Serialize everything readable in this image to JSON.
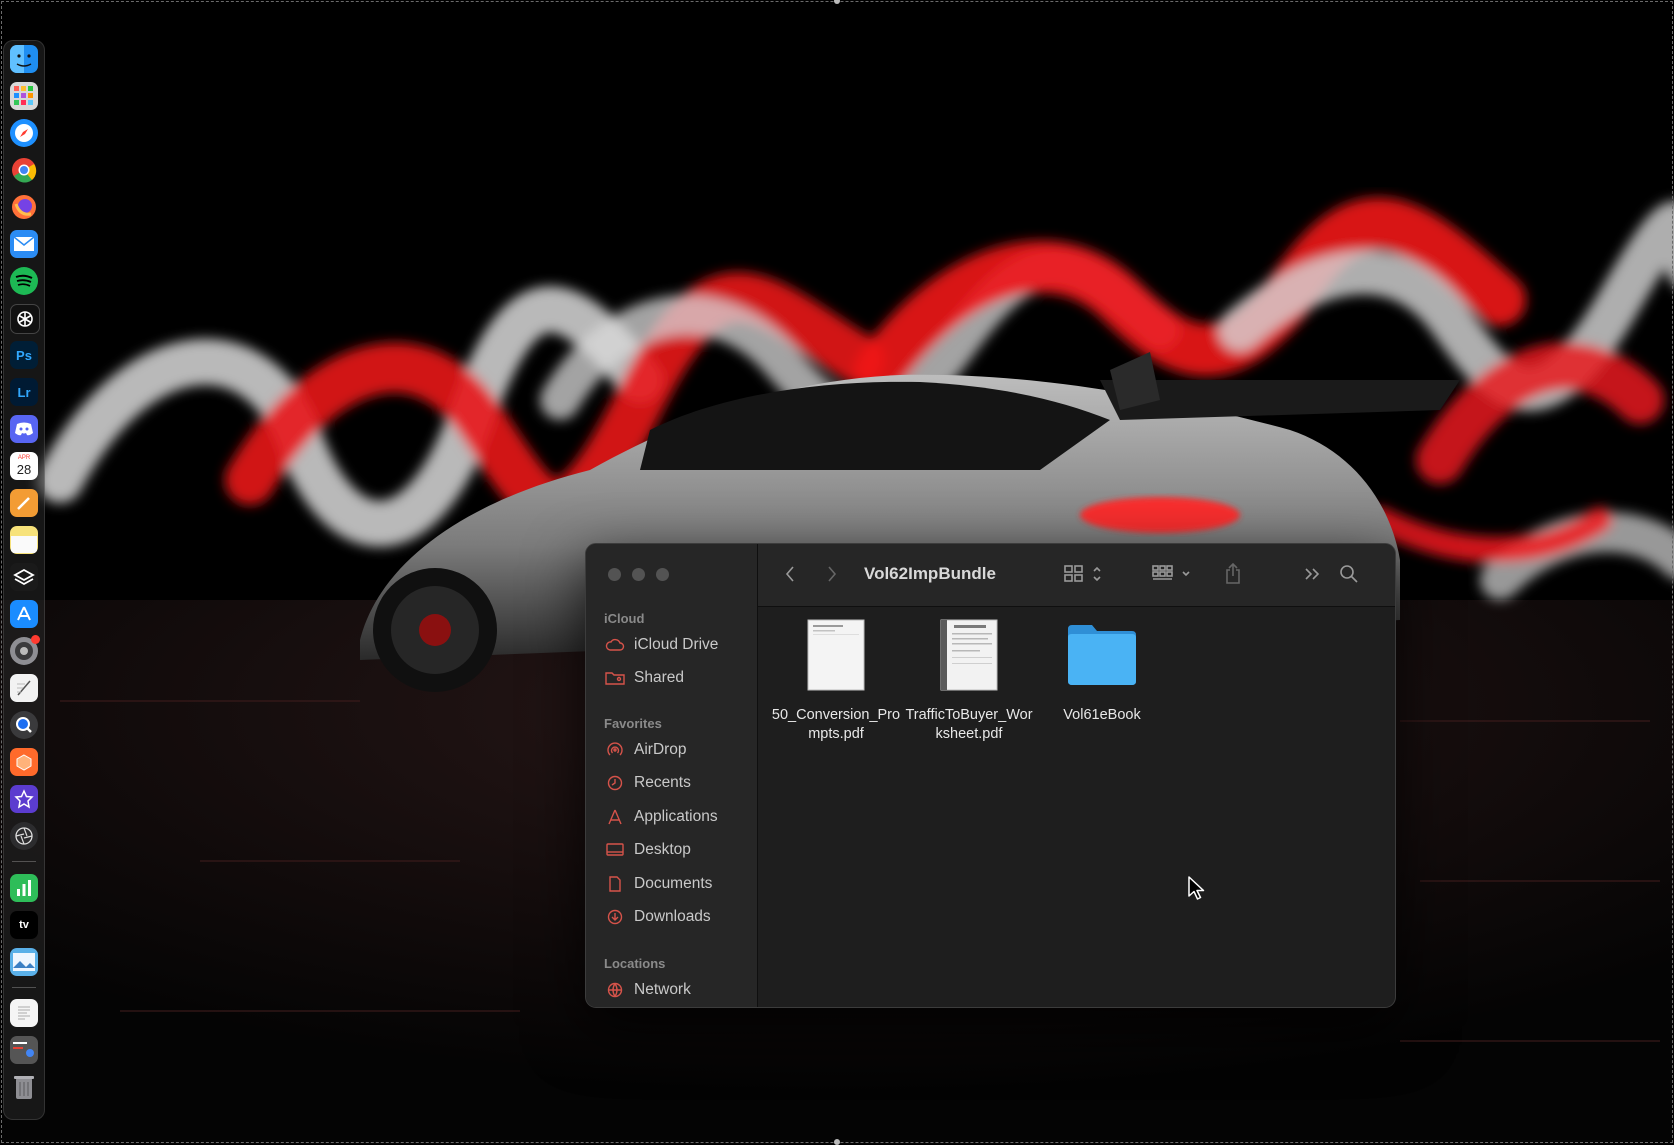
{
  "desktop": {
    "wallpaper": "sports-car-light-painting",
    "dock_apps": [
      {
        "name": "finder-icon",
        "color": "#1f8ef1"
      },
      {
        "name": "launchpad-icon",
        "color": "#e8e8e8"
      },
      {
        "name": "safari-icon",
        "color": "#1e90ff"
      },
      {
        "name": "chrome-icon",
        "color": "#e94235"
      },
      {
        "name": "firefox-icon",
        "color": "#ff7139"
      },
      {
        "name": "mail-icon",
        "color": "#2b8cf4"
      },
      {
        "name": "spotify-icon",
        "color": "#1db954"
      },
      {
        "name": "chatgpt-icon",
        "color": "#111111"
      },
      {
        "name": "photoshop-icon",
        "label": "Ps",
        "color": "#001e36"
      },
      {
        "name": "lightroom-icon",
        "label": "Lr",
        "color": "#001a33"
      },
      {
        "name": "discord-icon",
        "color": "#5865f2"
      },
      {
        "name": "calendar-icon",
        "label": "28",
        "month": "APR",
        "color": "#ffffff"
      },
      {
        "name": "pages-icon",
        "color": "#f39c34"
      },
      {
        "name": "notes-icon",
        "color": "#f7e27a"
      },
      {
        "name": "layers-app-icon",
        "color": "#1a1a1a"
      },
      {
        "name": "app-store-icon",
        "color": "#1a8cff"
      },
      {
        "name": "system-settings-icon",
        "color": "#8e8e93"
      },
      {
        "name": "textedit-icon",
        "color": "#f2f2f2"
      },
      {
        "name": "quicktime-icon",
        "color": "#3a3a3c"
      },
      {
        "name": "cube-app-icon",
        "color": "#ff6a2b"
      },
      {
        "name": "imovie-icon",
        "color": "#5b3ccf"
      },
      {
        "name": "aperture-app-icon",
        "color": "#2c2c2e"
      },
      {
        "name": "numbers-icon",
        "color": "#2ebd59"
      },
      {
        "name": "apple-tv-icon",
        "label": "tv",
        "color": "#000000"
      },
      {
        "name": "preview-icon",
        "color": "#5ab0e8"
      },
      {
        "name": "document-icon",
        "color": "#f5f5f5"
      },
      {
        "name": "recent-stack-icon",
        "color": "#555555"
      },
      {
        "name": "trash-icon",
        "color": "#7a7a7a"
      }
    ]
  },
  "finder": {
    "title": "Vol62ImpBundle",
    "sidebar": {
      "sections": [
        {
          "header": "iCloud",
          "items": [
            {
              "label": "iCloud Drive",
              "icon": "cloud-icon"
            },
            {
              "label": "Shared",
              "icon": "shared-folder-icon"
            }
          ]
        },
        {
          "header": "Favorites",
          "items": [
            {
              "label": "AirDrop",
              "icon": "airdrop-icon"
            },
            {
              "label": "Recents",
              "icon": "clock-icon"
            },
            {
              "label": "Applications",
              "icon": "applications-icon"
            },
            {
              "label": "Desktop",
              "icon": "desktop-icon"
            },
            {
              "label": "Documents",
              "icon": "document-icon"
            },
            {
              "label": "Downloads",
              "icon": "download-icon"
            }
          ]
        },
        {
          "header": "Locations",
          "items": [
            {
              "label": "Network",
              "icon": "network-icon"
            }
          ]
        }
      ]
    },
    "toolbar": {
      "back": "chevron-left-icon",
      "forward": "chevron-right-icon",
      "view": "grid-view-icon",
      "group": "group-by-icon",
      "share": "share-icon",
      "more": "double-chevron-right-icon",
      "search": "search-icon"
    },
    "files": [
      {
        "name": "50_Conversion_Prompts.pdf",
        "type": "pdf"
      },
      {
        "name": "TrafficToBuyer_Worksheet.pdf",
        "type": "pdf"
      },
      {
        "name": "Vol61eBook",
        "type": "folder"
      }
    ],
    "accent": "#d6534a",
    "folder_color": "#4ab3f4"
  }
}
